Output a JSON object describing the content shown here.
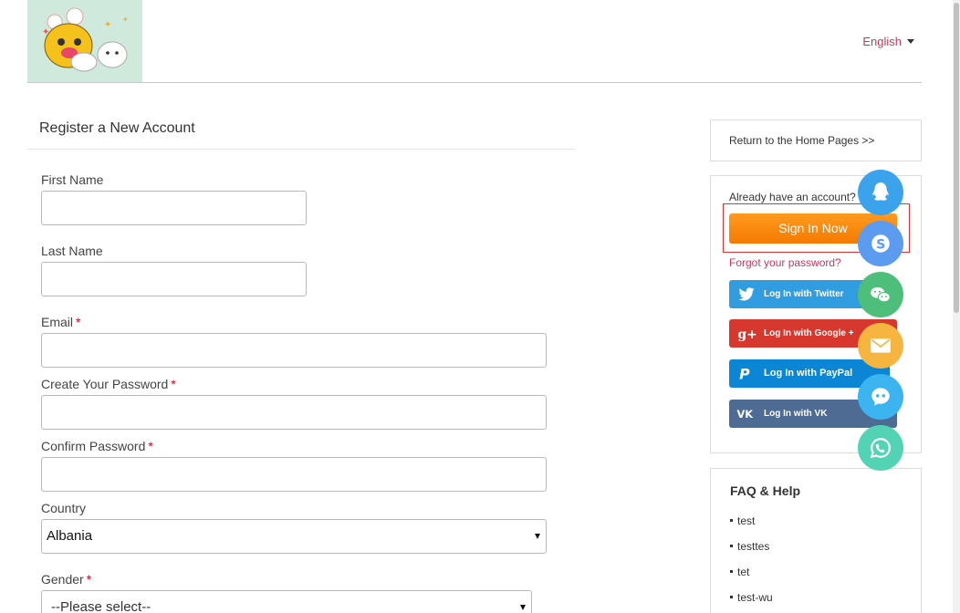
{
  "header": {
    "language": "English"
  },
  "form": {
    "title": "Register a New Account",
    "first_name_label": "First Name",
    "first_name_value": "",
    "last_name_label": "Last Name",
    "last_name_value": "",
    "email_label": "Email",
    "email_value": "",
    "password_label": "Create Your Password",
    "password_value": "",
    "confirm_label": "Confirm Password",
    "confirm_value": "",
    "country_label": "Country",
    "country_value": "Albania",
    "gender_label": "Gender",
    "gender_value": "--Please select--",
    "required_mark": "*"
  },
  "sidebar": {
    "return_link": "Return to the Home Pages >>",
    "already_text": "Already have an account?",
    "signin_label": "Sign In Now",
    "forgot_link": "Forgot your password?",
    "social": [
      {
        "label": "Log In with Twitter"
      },
      {
        "label": "Log In with Google +"
      },
      {
        "label": "Log In with PayPal"
      },
      {
        "label": "Log In with VK"
      }
    ],
    "faq_title": "FAQ & Help",
    "faq_items": [
      "test",
      "testtes",
      "tet",
      "test-wu"
    ]
  },
  "floating_contacts": [
    {
      "icon": "qq-icon",
      "color": "#3aa3ec"
    },
    {
      "icon": "skype-icon",
      "color": "#5b9bf0"
    },
    {
      "icon": "wechat-icon",
      "color": "#4dbf7a"
    },
    {
      "icon": "email-icon",
      "color": "#f5b53f"
    },
    {
      "icon": "chat-bot-icon",
      "color": "#3cb4f0"
    },
    {
      "icon": "whatsapp-icon",
      "color": "#52d4b4"
    }
  ],
  "colors": {
    "accent_pink": "#c8385a",
    "signin_orange": "#f57a00",
    "required_red": "#d0021b"
  }
}
